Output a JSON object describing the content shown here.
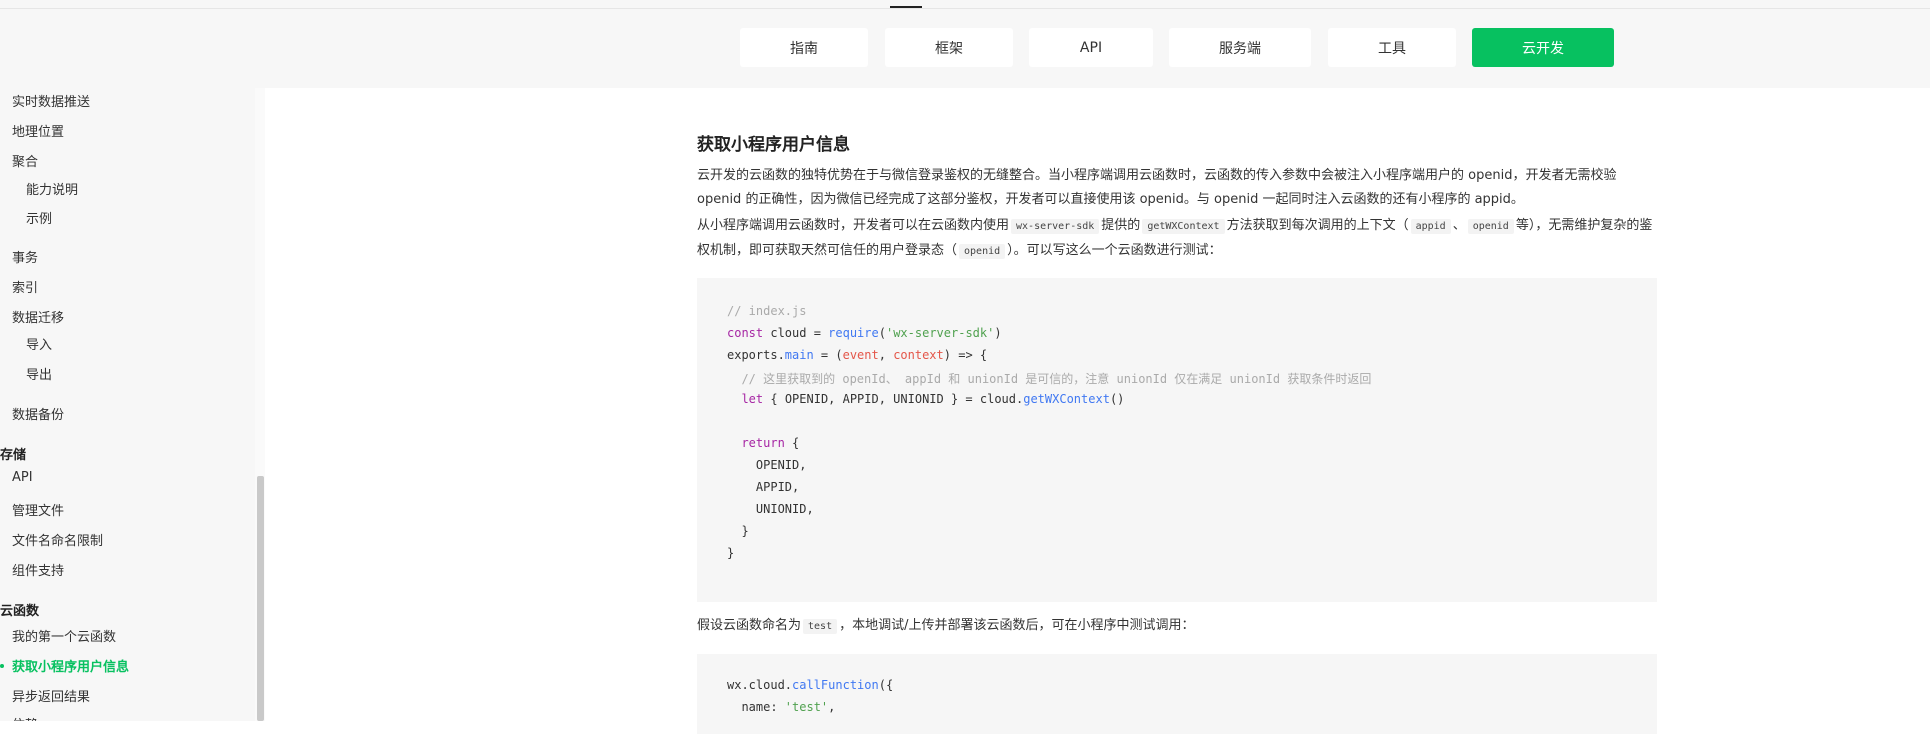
{
  "nav": {
    "tabs": [
      {
        "label": "指南"
      },
      {
        "label": "框架"
      },
      {
        "label": "API"
      },
      {
        "label": "服务端"
      },
      {
        "label": "工具"
      },
      {
        "label": "云开发"
      }
    ]
  },
  "sidebar": {
    "items": [
      {
        "label": "实时数据推送"
      },
      {
        "label": "地理位置"
      },
      {
        "label": "聚合"
      },
      {
        "label": "能力说明"
      },
      {
        "label": "示例"
      },
      {
        "label": "事务"
      },
      {
        "label": "索引"
      },
      {
        "label": "数据迁移"
      },
      {
        "label": "导入"
      },
      {
        "label": "导出"
      },
      {
        "label": "数据备份"
      },
      {
        "label": "存储"
      },
      {
        "label": "API"
      },
      {
        "label": "管理文件"
      },
      {
        "label": "文件名命名限制"
      },
      {
        "label": "组件支持"
      },
      {
        "label": "云函数"
      },
      {
        "label": "我的第一个云函数"
      },
      {
        "label": "获取小程序用户信息"
      },
      {
        "label": "异步返回结果"
      },
      {
        "label": "依赖"
      }
    ]
  },
  "content": {
    "title": "获取小程序用户信息",
    "p1": "云开发的云函数的独特优势在于与微信登录鉴权的无缝整合。当小程序端调用云函数时，云函数的传入参数中会被注入小程序端用户的 openid，开发者无需校验 openid 的正确性，因为微信已经完成了这部分鉴权，开发者可以直接使用该 openid。与 openid 一起同时注入云函数的还有小程序的 appid。",
    "p2": {
      "t1": "从小程序端调用云函数时，开发者可以在云函数内使用",
      "c1": "wx-server-sdk",
      "t2": "提供的",
      "c2": "getWXContext",
      "t3": "方法获取到每次调用的上下文（",
      "c3": "appid",
      "t4": "、",
      "c4": "openid",
      "t5": "等），无需维护复杂的鉴权机制，即可获取天然可信任的用户登录态（",
      "c5": "openid",
      "t6": "）。可以写这么一个云函数进行测试："
    },
    "code1": {
      "l1": "// index.js",
      "l2_kw": "const",
      "l2_a": " cloud = ",
      "l2_fn": "require",
      "l2_b": "(",
      "l2_str": "'wx-server-sdk'",
      "l2_c": ")",
      "l3_a": "exports.",
      "l3_fn": "main",
      "l3_b": " = (",
      "l3_p1": "event",
      "l3_c": ", ",
      "l3_p2": "context",
      "l3_d": ") => {",
      "l4": "  // 这里获取到的 openId、 appId 和 unionId 是可信的，注意 unionId 仅在满足 unionId 获取条件时返回",
      "l5_kw": "let",
      "l5_a": " { OPENID, APPID, UNIONID } = cloud.",
      "l5_fn": "getWXContext",
      "l5_b": "()",
      "l6_kw": "return",
      "l6_a": " {",
      "l7": "    OPENID,",
      "l8": "    APPID,",
      "l9": "    UNIONID,",
      "l10": "  }",
      "l11": "}"
    },
    "p3": {
      "t1": "假设云函数命名为",
      "c1": "test",
      "t2": "，本地调试/上传并部署该云函数后，可在小程序中测试调用："
    },
    "code2": {
      "l1_a": "wx.cloud.",
      "l1_fn": "callFunction",
      "l1_b": "({",
      "l2_a": "  name: ",
      "l2_str": "'test'",
      "l2_b": ","
    }
  }
}
